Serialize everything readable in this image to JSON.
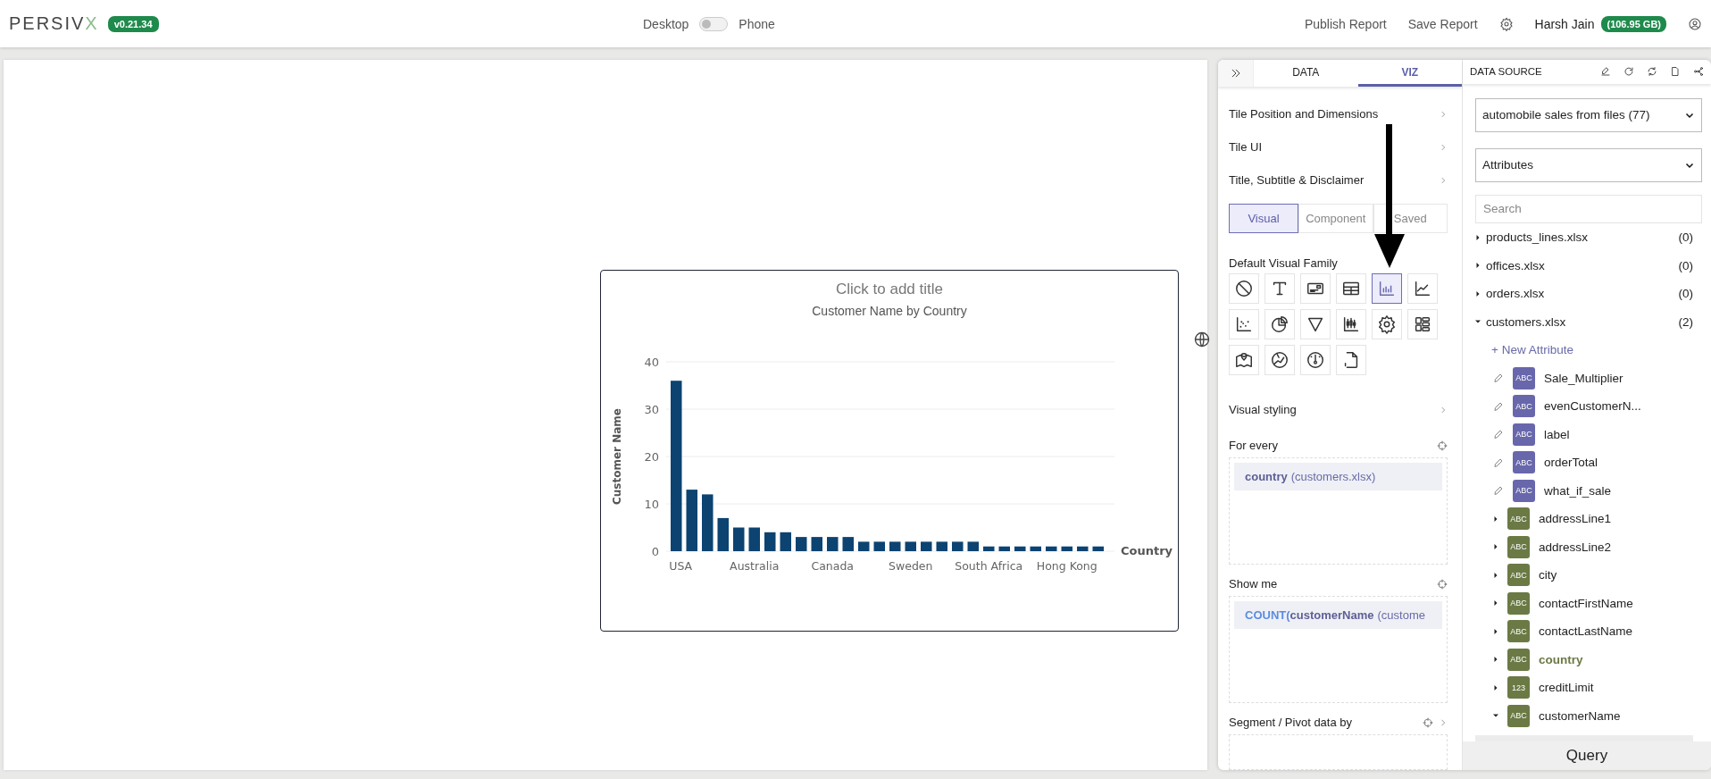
{
  "header": {
    "logo_main": "PERSIV",
    "logo_accent": "X",
    "version": "v0.21.34",
    "view_left": "Desktop",
    "view_toggle": {
      "on": false
    },
    "view_right": "Phone",
    "actions": [
      "Publish Report",
      "Save Report"
    ],
    "user": "Harsh Jain",
    "storage": "(106.95 GB)"
  },
  "tile": {
    "title_placeholder": "Click to add title",
    "chart_data": {
      "type": "bar",
      "title": "Customer Name by Country",
      "xlabel": "Country",
      "ylabel": "Customer Name",
      "categories": [
        "USA",
        null,
        null,
        null,
        null,
        "Australia",
        null,
        null,
        null,
        null,
        "Canada",
        null,
        null,
        null,
        null,
        "Sweden",
        null,
        null,
        null,
        null,
        "South Africa",
        null,
        null,
        null,
        null,
        "Hong Kong",
        null,
        null
      ],
      "values": [
        36,
        13,
        12,
        7,
        5,
        5,
        4,
        4,
        3,
        3,
        3,
        3,
        2,
        2,
        2,
        2,
        2,
        2,
        2,
        2,
        1,
        1,
        1,
        1,
        1,
        1,
        1,
        1
      ],
      "ylim": [
        0,
        40
      ],
      "yticks": [
        0,
        10,
        20,
        30,
        40
      ],
      "grid": true
    }
  },
  "viz_panel": {
    "tabs": [
      {
        "label": "DATA",
        "selected": false
      },
      {
        "label": "VIZ",
        "selected": true
      }
    ],
    "sections": [
      "Tile Position and Dimensions",
      "Tile UI",
      "Title, Subtitle & Disclaimer"
    ],
    "modes": [
      {
        "label": "Visual",
        "selected": true
      },
      {
        "label": "Component",
        "selected": false
      },
      {
        "label": "Saved",
        "selected": false
      }
    ],
    "family_label": "Default Visual Family",
    "families": [
      {
        "kind": "none",
        "selected": false
      },
      {
        "kind": "text",
        "selected": false
      },
      {
        "kind": "card",
        "selected": false
      },
      {
        "kind": "table",
        "selected": false
      },
      {
        "kind": "bar",
        "selected": true
      },
      {
        "kind": "line",
        "selected": false
      },
      {
        "kind": "scatter",
        "selected": false
      },
      {
        "kind": "pie",
        "selected": false
      },
      {
        "kind": "funnel",
        "selected": false
      },
      {
        "kind": "candlestick",
        "selected": false
      },
      {
        "kind": "gear",
        "selected": false
      },
      {
        "kind": "layout",
        "selected": false
      },
      {
        "kind": "map",
        "selected": false
      },
      {
        "kind": "radar",
        "selected": false
      },
      {
        "kind": "gauge",
        "selected": false
      },
      {
        "kind": "script",
        "selected": false
      }
    ],
    "styling": "Visual styling",
    "shelves": [
      {
        "label": "For every",
        "expandable": false,
        "chips": [
          {
            "field": "country",
            "source": "(customers.xlsx)"
          }
        ]
      },
      {
        "label": "Show me",
        "expandable": false,
        "chips": [
          {
            "func": "COUNT(",
            "field": "customerName",
            "source": "(custome"
          }
        ]
      },
      {
        "label": "Segment / Pivot data by",
        "expandable": true
      }
    ]
  },
  "data_source": {
    "title": "DATA SOURCE",
    "source_select": "automobile sales from files (77)",
    "view_select": "Attributes",
    "search_placeholder": "Search",
    "tables": [
      {
        "name": "products_lines.xlsx",
        "count": "(0)",
        "expanded": false
      },
      {
        "name": "offices.xlsx",
        "count": "(0)",
        "expanded": false
      },
      {
        "name": "orders.xlsx",
        "count": "(0)",
        "expanded": false
      },
      {
        "name": "customers.xlsx",
        "count": "(2)",
        "expanded": true,
        "new_attribute": "+ New Attribute",
        "attributes": [
          {
            "kind": "calculated",
            "type": "ABC",
            "name": "Sale_Multiplier",
            "in_use": false
          },
          {
            "kind": "calculated",
            "type": "ABC",
            "name": "evenCustomerN...",
            "in_use": false
          },
          {
            "kind": "calculated",
            "type": "ABC",
            "name": "label",
            "in_use": false
          },
          {
            "kind": "calculated",
            "type": "ABC",
            "name": "orderTotal",
            "in_use": false
          },
          {
            "kind": "calculated",
            "type": "ABC",
            "name": "what_if_sale",
            "in_use": false
          },
          {
            "kind": "column",
            "type": "ABC",
            "name": "addressLine1",
            "in_use": false,
            "expanded": false
          },
          {
            "kind": "column",
            "type": "ABC",
            "name": "addressLine2",
            "in_use": false,
            "expanded": false
          },
          {
            "kind": "column",
            "type": "ABC",
            "name": "city",
            "in_use": false,
            "expanded": false
          },
          {
            "kind": "column",
            "type": "ABC",
            "name": "contactFirstName",
            "in_use": false,
            "expanded": false
          },
          {
            "kind": "column",
            "type": "ABC",
            "name": "contactLastName",
            "in_use": false,
            "expanded": false
          },
          {
            "kind": "column",
            "type": "ABC",
            "name": "country",
            "in_use": true,
            "expanded": false
          },
          {
            "kind": "column",
            "type": "123",
            "name": "creditLimit",
            "in_use": false,
            "expanded": false
          },
          {
            "kind": "column",
            "type": "ABC",
            "name": "customerName",
            "in_use": false,
            "expanded": true
          }
        ]
      }
    ],
    "query_button": "Query"
  }
}
